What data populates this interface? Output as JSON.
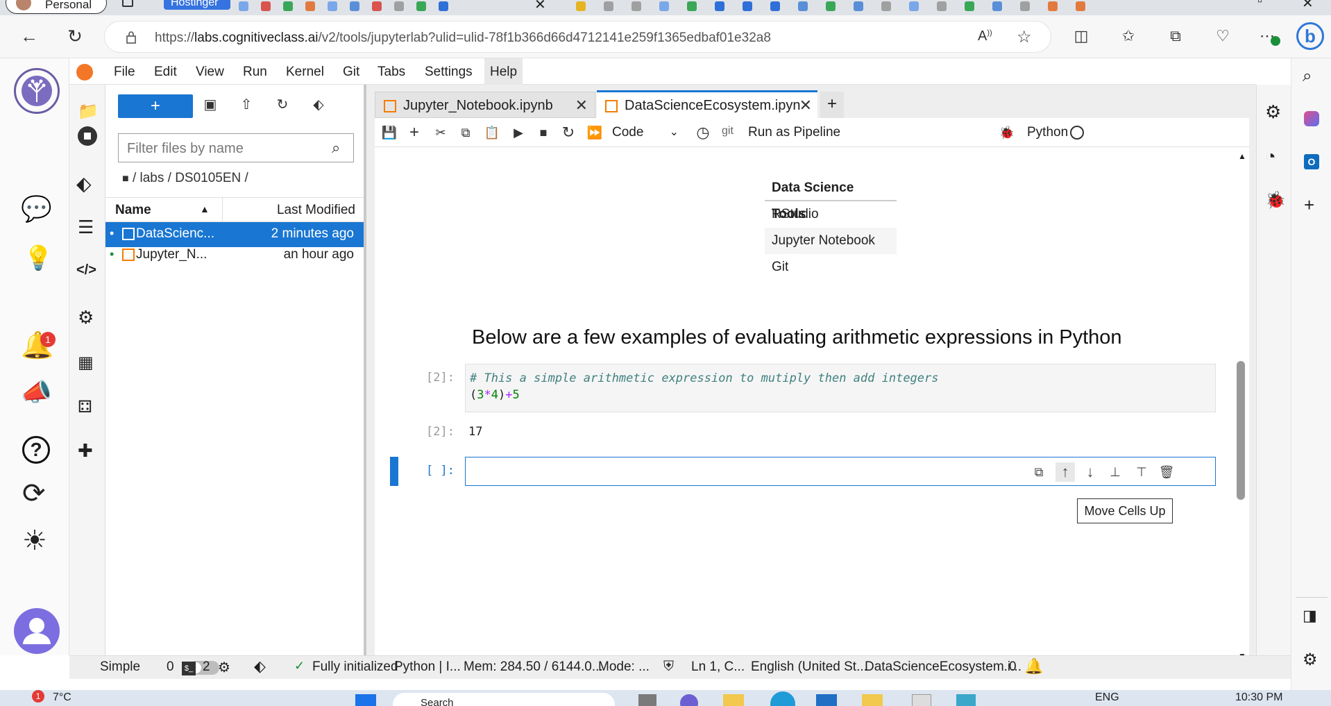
{
  "browser": {
    "profile_label": "Personal",
    "pinned_tab_label": "Hostinger",
    "url_prefix": "https://",
    "url_host": "labs.cognitiveclass.ai",
    "url_path": "/v2/tools/jupyterlab?ulid=ulid-78f1b366d66d4712141e259f1365edbaf01e32a8"
  },
  "menubar": {
    "items": [
      "File",
      "Edit",
      "View",
      "Run",
      "Kernel",
      "Git",
      "Tabs",
      "Settings",
      "Help"
    ]
  },
  "filebrowser": {
    "new_label": "+",
    "filter_placeholder": "Filter files by name",
    "breadcrumb": "/ labs / DS0105EN /",
    "col_name": "Name",
    "col_modified": "Last Modified",
    "files": [
      {
        "name": "DataScienc...",
        "modified": "2 minutes ago",
        "selected": true
      },
      {
        "name": "Jupyter_N...",
        "modified": "an hour ago",
        "selected": false
      }
    ]
  },
  "tabs": [
    {
      "label": "Jupyter_Notebook.ipynb"
    },
    {
      "label": "DataScienceEcosystem.ipyn"
    }
  ],
  "nbtoolbar": {
    "cell_type": "Code",
    "git_label": "git",
    "pipeline_label": "Run as Pipeline",
    "kernel_label": "Python"
  },
  "notebook": {
    "table_header": "Data Science Tools",
    "table_rows": [
      "RStudio",
      "Jupyter Notebook",
      "Git"
    ],
    "heading": "Below are a few examples of evaluating arithmetic expressions in Python",
    "cell1_prompt": "[2]:",
    "cell1_comment": "# This a simple arithmetic expression to mutiply then add integers",
    "cell1_code_open": "(",
    "cell1_code_3": "3",
    "cell1_code_mul": "*",
    "cell1_code_4": "4",
    "cell1_code_close": ")",
    "cell1_code_plus": "+",
    "cell1_code_5": "5",
    "out_prompt": "[2]:",
    "out_value": "17",
    "empty_prompt": "[ ]:",
    "tooltip": "Move Cells Up"
  },
  "statusbar": {
    "mode_label": "Simple",
    "terminals": "0",
    "kernels": "2",
    "status": "Fully initialized",
    "kernel": "Python | I...",
    "mem": "Mem: 284.50 / 6144.0...",
    "mode": "Mode: ...",
    "position": "Ln 1, C...",
    "language": "English (United St...",
    "file": "DataScienceEcosystem.i...",
    "notifications": "0"
  },
  "taskbar": {
    "weather_badge": "1",
    "temperature": "7°C",
    "search_label": "Search",
    "lang": "ENG",
    "time": "10:30 PM"
  },
  "notifications_badge": "1",
  "colors": {
    "accent": "#1976d2",
    "notebook_icon": "#f57c00",
    "badge": "#e53935"
  }
}
